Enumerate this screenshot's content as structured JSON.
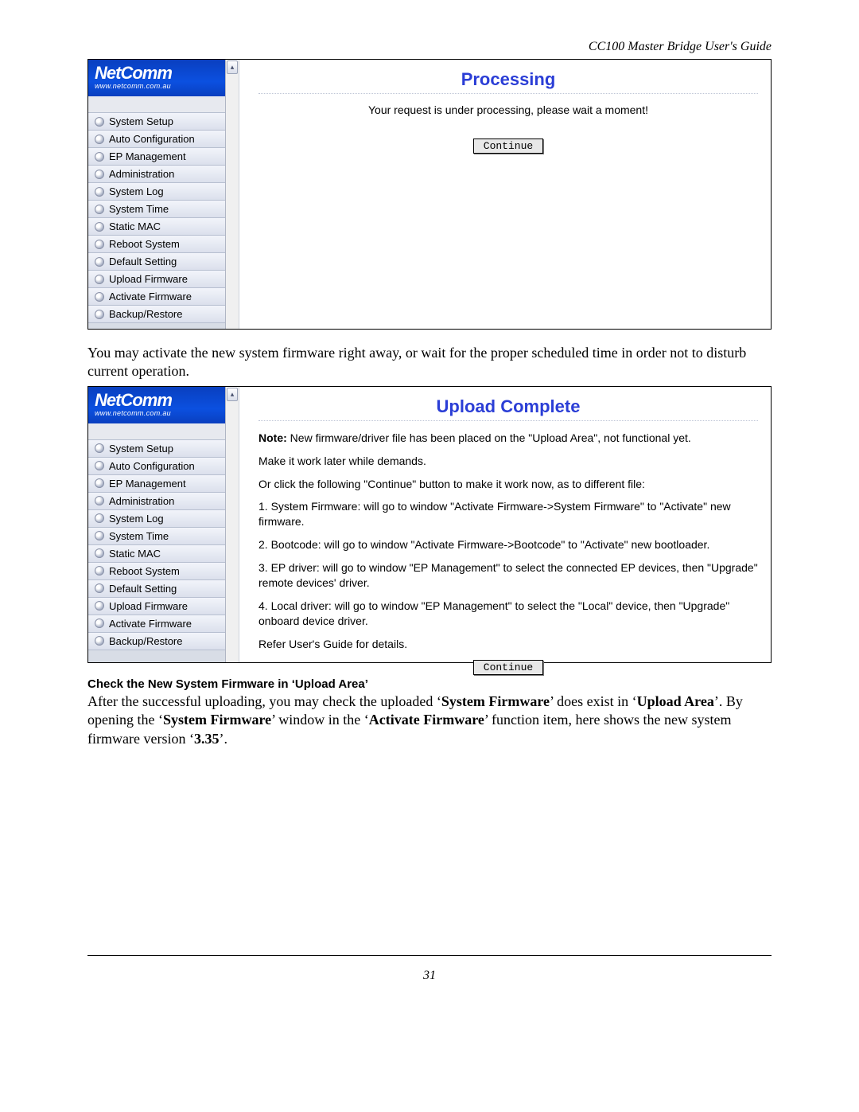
{
  "header": "CC100 Master Bridge User's Guide",
  "logo": {
    "main": "NetComm",
    "sub": "www.netcomm.com.au"
  },
  "nav": {
    "items": [
      "System Setup",
      "Auto Configuration",
      "EP Management",
      "Administration",
      "System Log",
      "System Time",
      "Static MAC",
      "Reboot System",
      "Default Setting",
      "Upload Firmware",
      "Activate Firmware",
      "Backup/Restore"
    ]
  },
  "processing": {
    "title": "Processing",
    "msg": "Your request is under processing, please wait a moment!",
    "button": "Continue"
  },
  "between_text": "You may activate the new system firmware right away, or wait for the proper scheduled time in order not to disturb current operation.",
  "upload": {
    "title": "Upload Complete",
    "note_label": "Note:",
    "note_rest": " New firmware/driver file has been placed on the \"Upload Area\", not functional yet.",
    "p1": "Make it work later while demands.",
    "p2": "Or click the following \"Continue\" button to make it work now, as to different file:",
    "p3": "1. System Firmware: will go to window \"Activate Firmware->System Firmware\" to \"Activate\" new firmware.",
    "p4": "2. Bootcode: will go to window \"Activate Firmware->Bootcode\" to \"Activate\" new bootloader.",
    "p5": "3. EP driver: will go to window \"EP Management\" to select the connected EP devices, then \"Upgrade\" remote devices' driver.",
    "p6": "4. Local driver: will go to window \"EP Management\" to select the \"Local\" device, then \"Upgrade\" onboard device driver.",
    "p7": "Refer User's Guide for details.",
    "button": "Continue"
  },
  "section_heading": "Check the New System Firmware in ‘Upload Area’",
  "doc_after": {
    "pre": "After the successful uploading, you may check the uploaded ‘",
    "b1": "System Firmware",
    "mid1": "’ does exist in ‘",
    "b2": "Upload Area",
    "mid2": "’. By opening the ‘",
    "b3": "System Firmware",
    "mid3": "’ window in the ‘",
    "b4": "Activate Firmware",
    "mid4": "’ function item, here shows the new system firmware version ‘",
    "b5": "3.35",
    "post": "’."
  },
  "page_number": "31"
}
